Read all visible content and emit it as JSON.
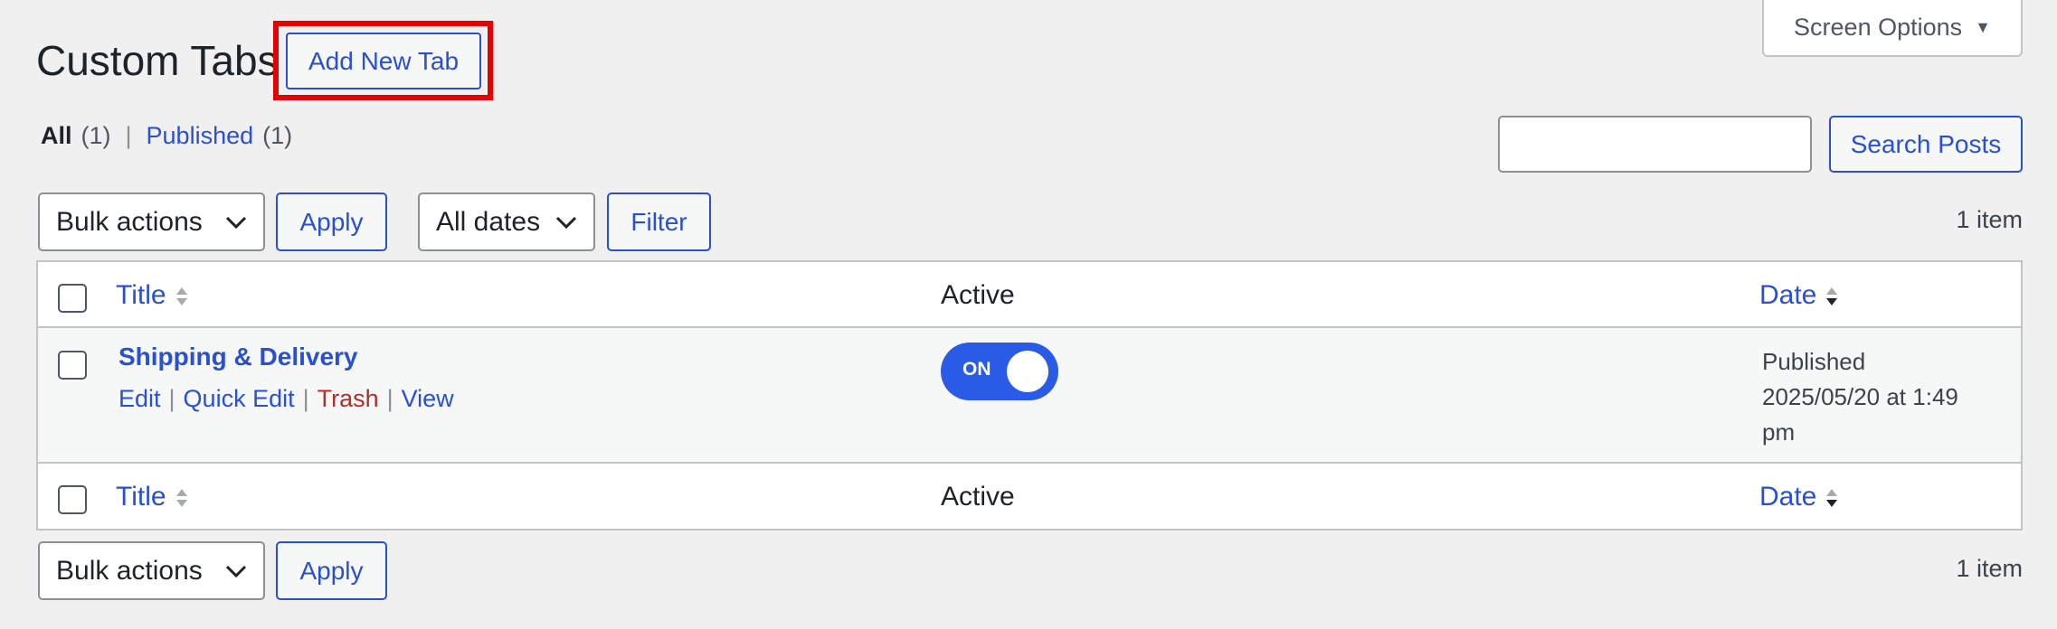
{
  "page": {
    "title": "Custom Tabs",
    "add_new_label": "Add New Tab",
    "screen_options_label": "Screen Options"
  },
  "views": {
    "all_label": "All",
    "all_count": "(1)",
    "separator": "|",
    "published_label": "Published",
    "published_count": "(1)"
  },
  "search": {
    "value": "",
    "button_label": "Search Posts"
  },
  "top_nav": {
    "bulk_actions": "Bulk actions",
    "apply_label": "Apply",
    "dates_filter": "All dates",
    "filter_label": "Filter",
    "item_count": "1 item"
  },
  "table": {
    "headers": {
      "title": "Title",
      "active": "Active",
      "date": "Date"
    },
    "rows": [
      {
        "title": "Shipping & Delivery",
        "actions": {
          "edit": "Edit",
          "quick_edit": "Quick Edit",
          "trash": "Trash",
          "view": "View",
          "sep": "|"
        },
        "toggle_label": "ON",
        "toggle_state": "on",
        "date_status": "Published",
        "date_line1": "2025/05/20 at 1:49",
        "date_line2": "pm"
      }
    ]
  },
  "bottom_nav": {
    "bulk_actions": "Bulk actions",
    "apply_label": "Apply",
    "item_count": "1 item"
  },
  "colors": {
    "link": "#2a4fd0",
    "trash": "#b32d2e",
    "highlight": "#e60000",
    "toggle_on": "#2a5be6"
  }
}
